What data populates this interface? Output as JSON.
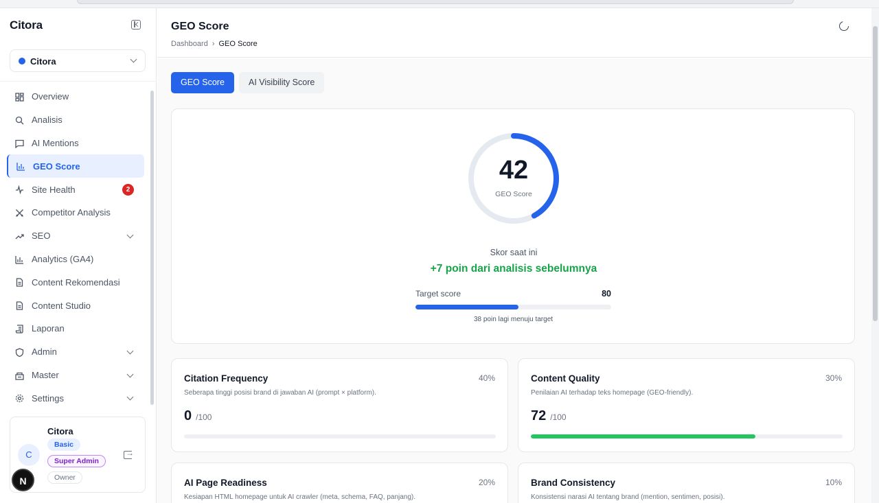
{
  "sidebar": {
    "brand": "Citora",
    "project": {
      "name": "Citora",
      "dot_color": "#2563eb"
    },
    "items": [
      {
        "label": "Overview",
        "icon": "grid-icon"
      },
      {
        "label": "Analisis",
        "icon": "search-icon"
      },
      {
        "label": "AI Mentions",
        "icon": "message-square-icon"
      },
      {
        "label": "GEO Score",
        "icon": "bar-chart-icon",
        "active": true
      },
      {
        "label": "Site Health",
        "icon": "activity-icon",
        "badge": "2"
      },
      {
        "label": "Competitor Analysis",
        "icon": "swords-icon"
      },
      {
        "label": "SEO",
        "icon": "trending-up-icon",
        "expandable": true
      },
      {
        "label": "Analytics (GA4)",
        "icon": "bar-chart-icon"
      },
      {
        "label": "Content Rekomendasi",
        "icon": "file-icon"
      },
      {
        "label": "Content Studio",
        "icon": "file-icon"
      },
      {
        "label": "Laporan",
        "icon": "scroll-icon"
      },
      {
        "label": "Admin",
        "icon": "shield-icon",
        "expandable": true
      },
      {
        "label": "Master",
        "icon": "database-icon",
        "expandable": true
      },
      {
        "label": "Settings",
        "icon": "gear-icon",
        "expandable": true
      }
    ],
    "user": {
      "initial": "C",
      "name": "Citora",
      "tags": [
        "Basic",
        "Super Admin",
        "Owner"
      ]
    },
    "floating_badge": "N"
  },
  "header": {
    "title": "GEO Score",
    "breadcrumb": [
      "Dashboard",
      "GEO Score"
    ]
  },
  "tabs": [
    {
      "label": "GEO Score",
      "active": true
    },
    {
      "label": "AI Visibility Score",
      "active": false
    }
  ],
  "hero": {
    "score": "42",
    "score_value": 42,
    "score_max": 100,
    "score_label": "GEO Score",
    "current_label": "Skor saat ini",
    "delta_text": "+7 poin dari analisis sebelumnya",
    "target_label": "Target score",
    "target_value": "80",
    "progress_fraction": 0.525,
    "target_note": "38 poin lagi menuju target",
    "colors": {
      "accent": "#2563eb",
      "positive": "#16a34a"
    }
  },
  "cards": [
    {
      "title": "Citation Frequency",
      "weight": "40%",
      "desc": "Seberapa tinggi posisi brand di jawaban AI (prompt × platform).",
      "score": "0",
      "max": "/100",
      "value": 0
    },
    {
      "title": "Content Quality",
      "weight": "30%",
      "desc": "Penilaian AI terhadap teks homepage (GEO-friendly).",
      "score": "72",
      "max": "/100",
      "value": 72
    },
    {
      "title": "AI Page Readiness",
      "weight": "20%",
      "desc": "Kesiapan HTML homepage untuk AI crawler (meta, schema, FAQ, panjang).",
      "score": "",
      "max": "",
      "value": null
    },
    {
      "title": "Brand Consistency",
      "weight": "10%",
      "desc": "Konsistensi narasi AI tentang brand (mention, sentimen, posisi).",
      "score": "",
      "max": "",
      "value": null
    }
  ]
}
